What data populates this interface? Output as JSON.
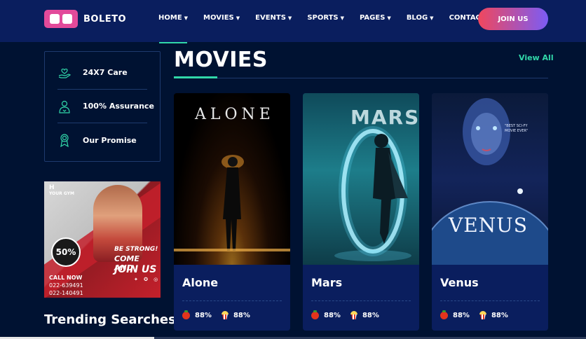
{
  "header": {
    "logo_text": "BOLETO",
    "nav": [
      {
        "label": "HOME",
        "dropdown": true
      },
      {
        "label": "MOVIES",
        "dropdown": true
      },
      {
        "label": "EVENTS",
        "dropdown": true
      },
      {
        "label": "SPORTS",
        "dropdown": true
      },
      {
        "label": "PAGES",
        "dropdown": true
      },
      {
        "label": "BLOG",
        "dropdown": true
      },
      {
        "label": "CONTACT",
        "dropdown": false
      }
    ],
    "join_label": "JOIN US"
  },
  "sidebar": {
    "features": [
      {
        "label": "24X7 Care",
        "icon": "hand-heart-icon"
      },
      {
        "label": "100% Assurance",
        "icon": "person-badge-icon"
      },
      {
        "label": "Our Promise",
        "icon": "award-ribbon-icon"
      }
    ],
    "ad": {
      "gym_logo_top": "H",
      "gym_logo_bottom": "YOUR GYM",
      "discount": "50%",
      "line1": "BE STRONG!",
      "line2": "COME AND",
      "line3": "JOIN US",
      "call": "CALL NOW",
      "phone1": "022-639491",
      "phone2": "022-140491",
      "socials": "✦ ✪ ◎"
    },
    "trending_title": "Trending Searches"
  },
  "main": {
    "title": "MOVIES",
    "view_all": "View All",
    "movies": [
      {
        "title": "Alone",
        "poster_text": "ALONE",
        "tomato": "88%",
        "audience": "88%"
      },
      {
        "title": "Mars",
        "poster_text": "MARS",
        "tomato": "88%",
        "audience": "88%"
      },
      {
        "title": "Venus",
        "poster_text": "VENUS",
        "tagline": "\"BEST SCI-FY MOVIE EVER\"",
        "tomato": "88%",
        "audience": "88%"
      }
    ]
  },
  "colors": {
    "background": "#001232",
    "header": "#0a1e5e",
    "accent": "#31d7a9",
    "button_start": "#f0475d",
    "button_end": "#7b5cf5"
  }
}
